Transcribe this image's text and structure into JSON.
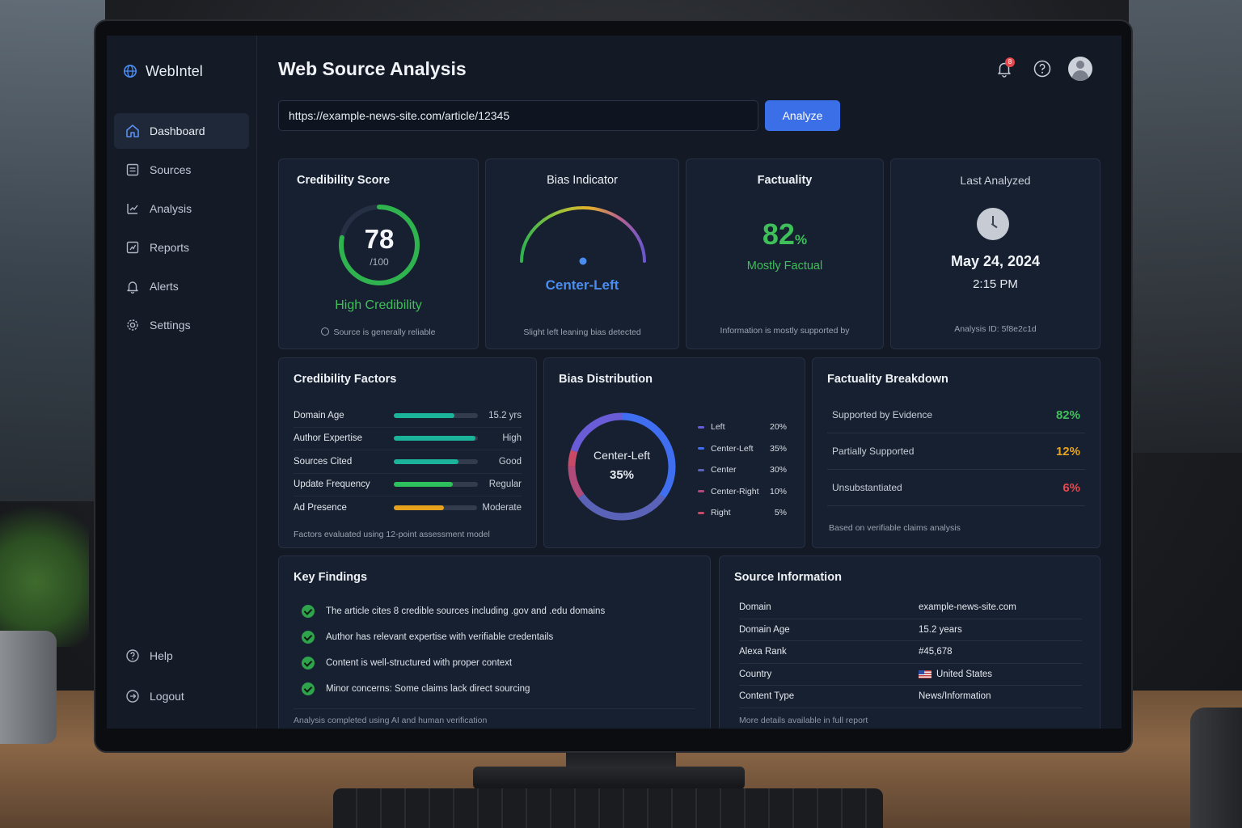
{
  "app": {
    "brand": "WebIntel",
    "page_title": "Web Source Analysis",
    "notification_count": "8"
  },
  "sidebar": {
    "items": [
      {
        "label": "Dashboard",
        "icon": "home-icon",
        "active": true
      },
      {
        "label": "Sources",
        "icon": "list-icon"
      },
      {
        "label": "Analysis",
        "icon": "chart-edit-icon"
      },
      {
        "label": "Reports",
        "icon": "report-icon"
      },
      {
        "label": "Alerts",
        "icon": "bell-icon"
      },
      {
        "label": "Settings",
        "icon": "gear-icon"
      }
    ],
    "bottom": [
      {
        "label": "Help",
        "icon": "help-icon"
      },
      {
        "label": "Logout",
        "icon": "logout-icon"
      }
    ]
  },
  "search": {
    "url": "https://example-news-site.com/article/12345",
    "button": "Analyze"
  },
  "credibility": {
    "title": "Credibility Score",
    "score": "78",
    "max": "/100",
    "score_value": 78,
    "label": "High Credibility",
    "note": "Source is generally reliable"
  },
  "bias": {
    "title": "Bias Indicator",
    "label": "Center-Left",
    "note": "Slight left leaning bias detected"
  },
  "factuality": {
    "title": "Factuality",
    "percent": "82",
    "unit": "%",
    "label": "Mostly Factual",
    "note": "Information is mostly supported by"
  },
  "last_analyzed": {
    "title": "Last Analyzed",
    "date": "May 24, 2024",
    "time": "2:15 PM",
    "analysis_id": "Analysis ID: 5f8e2c1d"
  },
  "factors": {
    "title": "Credibility Factors",
    "rows": [
      {
        "name": "Domain Age",
        "level": 0.72,
        "value": "15.2 yrs",
        "color": "#1bb39a"
      },
      {
        "name": "Author Expertise",
        "level": 0.97,
        "value": "High",
        "color": "#1bb39a"
      },
      {
        "name": "Sources Cited",
        "level": 0.77,
        "value": "Good",
        "color": "#1bb39a"
      },
      {
        "name": "Update Frequency",
        "level": 0.7,
        "value": "Regular",
        "color": "#2ec05c"
      },
      {
        "name": "Ad Presence",
        "level": 0.6,
        "value": "Moderate",
        "color": "#e6a21c"
      }
    ],
    "note": "Factors evaluated using 12-point assessment model"
  },
  "distribution": {
    "title": "Bias Distribution",
    "center_label": "Center-Left",
    "center_value": "35%",
    "segments": [
      {
        "name": "Left",
        "value": "20%",
        "pct": 20,
        "color": "#6a5bd6"
      },
      {
        "name": "Center-Left",
        "value": "35%",
        "pct": 35,
        "color": "#3f6ff0"
      },
      {
        "name": "Center",
        "value": "30%",
        "pct": 30,
        "color": "#5a63b8"
      },
      {
        "name": "Center-Right",
        "value": "10%",
        "pct": 10,
        "color": "#b04a7a"
      },
      {
        "name": "Right",
        "value": "5%",
        "pct": 5,
        "color": "#c94a66"
      }
    ]
  },
  "breakdown": {
    "title": "Factuality Breakdown",
    "rows": [
      {
        "name": "Supported by Evidence",
        "value": "82%",
        "color": "#3fbf5a"
      },
      {
        "name": "Partially Supported",
        "value": "12%",
        "color": "#e6a21c"
      },
      {
        "name": "Unsubstantiated",
        "value": "6%",
        "color": "#e5484d"
      }
    ],
    "note": "Based on verifiable claims analysis"
  },
  "findings": {
    "title": "Key Findings",
    "items": [
      "The article cites 8 credible sources including .gov and .edu domains",
      "Author has relevant expertise with verifiable credentails",
      "Content is well-structured with proper context",
      "Minor concerns: Some claims lack direct sourcing"
    ],
    "note": "Analysis completed using AI and human verification"
  },
  "source_info": {
    "title": "Source Information",
    "rows": [
      {
        "key": "Domain",
        "value": "example-news-site.com"
      },
      {
        "key": "Domain Age",
        "value": "15.2 years"
      },
      {
        "key": "Alexa Rank",
        "value": "#45,678"
      },
      {
        "key": "Country",
        "value": "United States",
        "flag": "us-flag-icon"
      },
      {
        "key": "Content Type",
        "value": "News/Information"
      }
    ],
    "note": "More details available in full report"
  }
}
